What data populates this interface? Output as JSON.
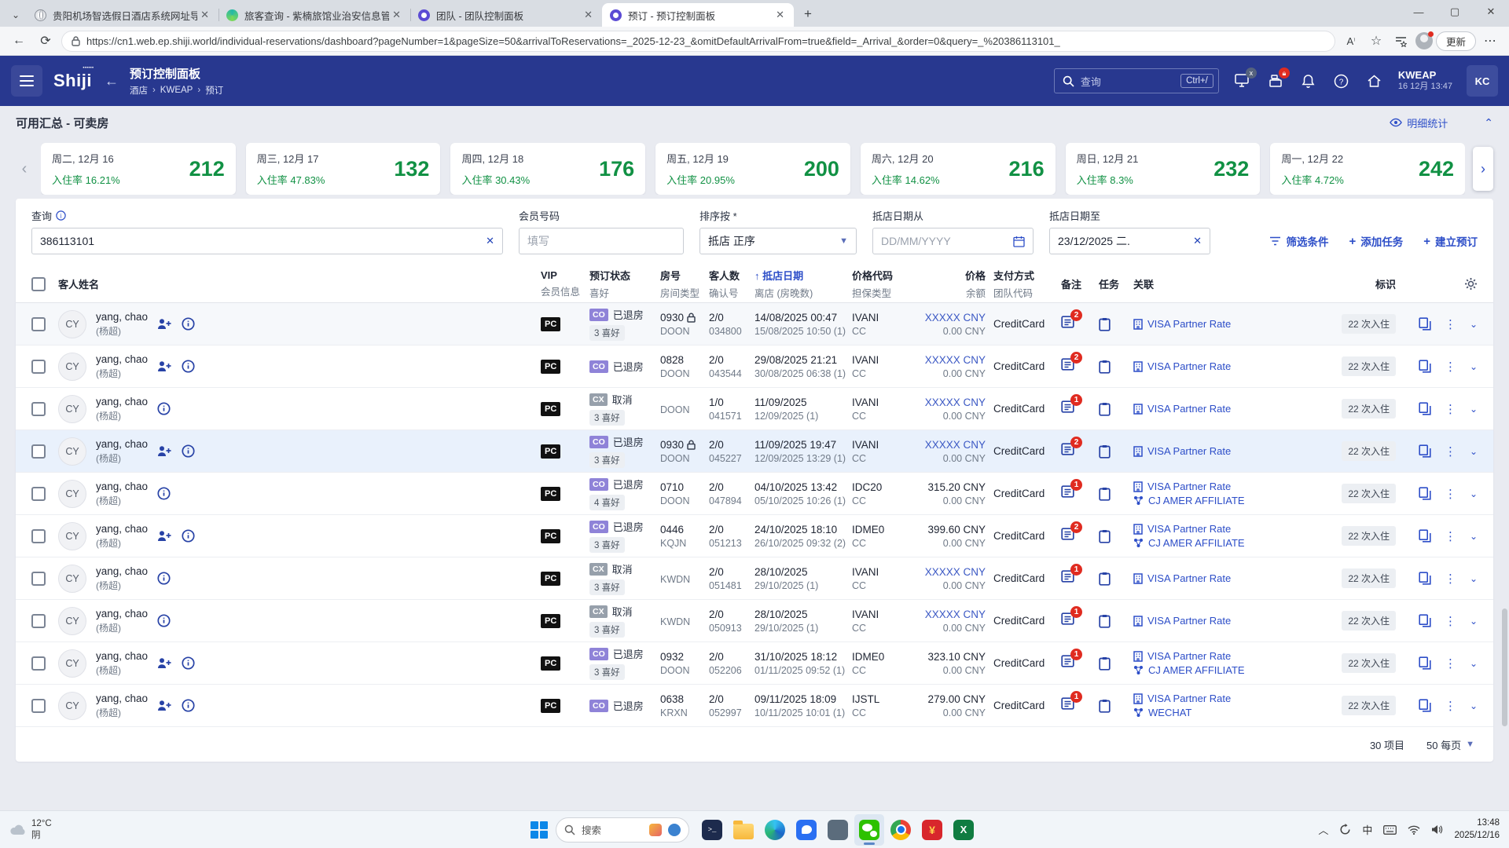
{
  "colors": {
    "header_blue": "#28388f",
    "accent_blue": "#2d4ec8",
    "green": "#119144",
    "red_badge": "#e02b20",
    "co_badge": "#8f83d8",
    "cx_badge": "#97a0ab",
    "wechat_green": "#2dc100"
  },
  "browser": {
    "tabs": [
      {
        "title": "贵阳机场智选假日酒店系统网址导",
        "favicon": "globe",
        "active": false
      },
      {
        "title": "旅客查询 - 紫楠旅馆业治安信息管",
        "favicon": "teal",
        "active": false
      },
      {
        "title": "团队 - 团队控制面板",
        "favicon": "purple",
        "active": false
      },
      {
        "title": "预订 - 预订控制面板",
        "favicon": "purple",
        "active": true
      }
    ],
    "url": "https://cn1.web.ep.shiji.world/individual-reservations/dashboard?pageNumber=1&pageSize=50&arrivalToReservations=_2025-12-23_&omitDefaultArrivalFrom=true&field=_Arrival_&order=0&query=_%20386113101_",
    "update_button": "更新"
  },
  "header": {
    "logo": "Shiji",
    "title": "预订控制面板",
    "breadcrumb": [
      "酒店",
      "KWEAP",
      "预订"
    ],
    "search_placeholder": "查询",
    "search_shortcut": "Ctrl+/",
    "property": "KWEAP",
    "datetime": "16 12月 13:47",
    "avatar": "KC"
  },
  "availability": {
    "title": "可用汇总 - 可卖房",
    "detail_link": "明细统计",
    "occupancy_label": "入住率",
    "cards": [
      {
        "date": "周二, 12月 16",
        "occupancy": "16.21%",
        "available": "212"
      },
      {
        "date": "周三, 12月 17",
        "occupancy": "47.83%",
        "available": "132"
      },
      {
        "date": "周四, 12月 18",
        "occupancy": "30.43%",
        "available": "176"
      },
      {
        "date": "周五, 12月 19",
        "occupancy": "20.95%",
        "available": "200"
      },
      {
        "date": "周六, 12月 20",
        "occupancy": "14.62%",
        "available": "216"
      },
      {
        "date": "周日, 12月 21",
        "occupancy": "8.3%",
        "available": "232"
      },
      {
        "date": "周一, 12月 22",
        "occupancy": "4.72%",
        "available": "242"
      }
    ]
  },
  "filters": {
    "query_label": "查询",
    "query_value": "386113101",
    "member_label": "会员号码",
    "member_placeholder": "填写",
    "sort_label": "排序按 *",
    "sort_value": "抵店 正序",
    "arrival_from_label": "抵店日期从",
    "arrival_from_placeholder": "DD/MM/YYYY",
    "arrival_to_label": "抵店日期至",
    "arrival_to_value": "23/12/2025 二.",
    "btn_filter": "筛选条件",
    "btn_add_task": "添加任务",
    "btn_new_reservation": "建立预订"
  },
  "table": {
    "headers": {
      "guest": "客人姓名",
      "vip": [
        "VIP",
        "会员信息"
      ],
      "status": [
        "预订状态",
        "喜好"
      ],
      "room": [
        "房号",
        "房间类型"
      ],
      "guests": [
        "客人数",
        "确认号"
      ],
      "arrival": [
        "抵店日期",
        "离店 (房晚数)"
      ],
      "rate": [
        "价格代码",
        "担保类型"
      ],
      "price": [
        "价格",
        "余额"
      ],
      "payment": [
        "支付方式",
        "团队代码"
      ],
      "notes": "备注",
      "tasks": "任务",
      "links": "关联",
      "tag": "标识"
    },
    "rows": [
      {
        "initials": "CY",
        "name": "yang, chao",
        "alt_name": "(杨超)",
        "contact_icon": true,
        "vip": "PC",
        "status_code": "CO",
        "status": "已退房",
        "status_kind": "co",
        "prefs": "3 喜好",
        "room": "0930",
        "locked": true,
        "room_type": "DOON",
        "guests": "2/0",
        "conf": "034800",
        "arrival": "14/08/2025 00:47",
        "departure": "15/08/2025 10:50 (1)",
        "rate_code": "IVANI",
        "guarantee": "CC",
        "price": "XXXXX CNY",
        "price_masked": true,
        "balance": "0.00 CNY",
        "payment": "CreditCard",
        "notes": "2",
        "links": [
          {
            "icon": "building",
            "label": "VISA Partner Rate"
          }
        ],
        "tag": "22 次入住",
        "highlight": false
      },
      {
        "initials": "CY",
        "name": "yang, chao",
        "alt_name": "(杨超)",
        "contact_icon": true,
        "vip": "PC",
        "status_code": "CO",
        "status": "已退房",
        "status_kind": "co",
        "prefs": "",
        "room": "0828",
        "locked": false,
        "room_type": "DOON",
        "guests": "2/0",
        "conf": "043544",
        "arrival": "29/08/2025 21:21",
        "departure": "30/08/2025 06:38 (1)",
        "rate_code": "IVANI",
        "guarantee": "CC",
        "price": "XXXXX CNY",
        "price_masked": true,
        "balance": "0.00 CNY",
        "payment": "CreditCard",
        "notes": "2",
        "links": [
          {
            "icon": "building",
            "label": "VISA Partner Rate"
          }
        ],
        "tag": "22 次入住",
        "highlight": false
      },
      {
        "initials": "CY",
        "name": "yang, chao",
        "alt_name": "(杨超)",
        "contact_icon": false,
        "vip": "PC",
        "status_code": "CX",
        "status": "取消",
        "status_kind": "cx",
        "prefs": "3 喜好",
        "room": "",
        "locked": false,
        "room_type": "DOON",
        "guests": "1/0",
        "conf": "041571",
        "arrival": "11/09/2025",
        "departure": "12/09/2025 (1)",
        "rate_code": "IVANI",
        "guarantee": "CC",
        "price": "XXXXX CNY",
        "price_masked": true,
        "balance": "0.00 CNY",
        "payment": "CreditCard",
        "notes": "1",
        "links": [
          {
            "icon": "building",
            "label": "VISA Partner Rate"
          }
        ],
        "tag": "22 次入住",
        "highlight": false
      },
      {
        "initials": "CY",
        "name": "yang, chao",
        "alt_name": "(杨超)",
        "contact_icon": true,
        "vip": "PC",
        "status_code": "CO",
        "status": "已退房",
        "status_kind": "co",
        "prefs": "3 喜好",
        "room": "0930",
        "locked": true,
        "room_type": "DOON",
        "guests": "2/0",
        "conf": "045227",
        "arrival": "11/09/2025 19:47",
        "departure": "12/09/2025 13:29 (1)",
        "rate_code": "IVANI",
        "guarantee": "CC",
        "price": "XXXXX CNY",
        "price_masked": true,
        "balance": "0.00 CNY",
        "payment": "CreditCard",
        "notes": "2",
        "links": [
          {
            "icon": "building",
            "label": "VISA Partner Rate"
          }
        ],
        "tag": "22 次入住",
        "highlight": true
      },
      {
        "initials": "CY",
        "name": "yang, chao",
        "alt_name": "(杨超)",
        "contact_icon": false,
        "vip": "PC",
        "status_code": "CO",
        "status": "已退房",
        "status_kind": "co",
        "prefs": "4 喜好",
        "room": "0710",
        "locked": false,
        "room_type": "DOON",
        "guests": "2/0",
        "conf": "047894",
        "arrival": "04/10/2025 13:42",
        "departure": "05/10/2025 10:26 (1)",
        "rate_code": "IDC20",
        "guarantee": "CC",
        "price": "315.20 CNY",
        "price_masked": false,
        "balance": "0.00 CNY",
        "payment": "CreditCard",
        "notes": "1",
        "links": [
          {
            "icon": "building",
            "label": "VISA Partner Rate"
          },
          {
            "icon": "affiliate",
            "label": "CJ AMER AFFILIATE"
          }
        ],
        "tag": "22 次入住",
        "highlight": false
      },
      {
        "initials": "CY",
        "name": "yang, chao",
        "alt_name": "(杨超)",
        "contact_icon": true,
        "vip": "PC",
        "status_code": "CO",
        "status": "已退房",
        "status_kind": "co",
        "prefs": "3 喜好",
        "room": "0446",
        "locked": false,
        "room_type": "KQJN",
        "guests": "2/0",
        "conf": "051213",
        "arrival": "24/10/2025 18:10",
        "departure": "26/10/2025 09:32 (2)",
        "rate_code": "IDME0",
        "guarantee": "CC",
        "price": "399.60 CNY",
        "price_masked": false,
        "balance": "0.00 CNY",
        "payment": "CreditCard",
        "notes": "2",
        "links": [
          {
            "icon": "building",
            "label": "VISA Partner Rate"
          },
          {
            "icon": "affiliate",
            "label": "CJ AMER AFFILIATE"
          }
        ],
        "tag": "22 次入住",
        "highlight": false
      },
      {
        "initials": "CY",
        "name": "yang, chao",
        "alt_name": "(杨超)",
        "contact_icon": false,
        "vip": "PC",
        "status_code": "CX",
        "status": "取消",
        "status_kind": "cx",
        "prefs": "3 喜好",
        "room": "",
        "locked": false,
        "room_type": "KWDN",
        "guests": "2/0",
        "conf": "051481",
        "arrival": "28/10/2025",
        "departure": "29/10/2025 (1)",
        "rate_code": "IVANI",
        "guarantee": "CC",
        "price": "XXXXX CNY",
        "price_masked": true,
        "balance": "0.00 CNY",
        "payment": "CreditCard",
        "notes": "1",
        "links": [
          {
            "icon": "building",
            "label": "VISA Partner Rate"
          }
        ],
        "tag": "22 次入住",
        "highlight": false
      },
      {
        "initials": "CY",
        "name": "yang, chao",
        "alt_name": "(杨超)",
        "contact_icon": false,
        "vip": "PC",
        "status_code": "CX",
        "status": "取消",
        "status_kind": "cx",
        "prefs": "3 喜好",
        "room": "",
        "locked": false,
        "room_type": "KWDN",
        "guests": "2/0",
        "conf": "050913",
        "arrival": "28/10/2025",
        "departure": "29/10/2025 (1)",
        "rate_code": "IVANI",
        "guarantee": "CC",
        "price": "XXXXX CNY",
        "price_masked": true,
        "balance": "0.00 CNY",
        "payment": "CreditCard",
        "notes": "1",
        "links": [
          {
            "icon": "building",
            "label": "VISA Partner Rate"
          }
        ],
        "tag": "22 次入住",
        "highlight": false
      },
      {
        "initials": "CY",
        "name": "yang, chao",
        "alt_name": "(杨超)",
        "contact_icon": true,
        "vip": "PC",
        "status_code": "CO",
        "status": "已退房",
        "status_kind": "co",
        "prefs": "3 喜好",
        "room": "0932",
        "locked": false,
        "room_type": "DOON",
        "guests": "2/0",
        "conf": "052206",
        "arrival": "31/10/2025 18:12",
        "departure": "01/11/2025 09:52 (1)",
        "rate_code": "IDME0",
        "guarantee": "CC",
        "price": "323.10 CNY",
        "price_masked": false,
        "balance": "0.00 CNY",
        "payment": "CreditCard",
        "notes": "1",
        "links": [
          {
            "icon": "building",
            "label": "VISA Partner Rate"
          },
          {
            "icon": "affiliate",
            "label": "CJ AMER AFFILIATE"
          }
        ],
        "tag": "22 次入住",
        "highlight": false
      },
      {
        "initials": "CY",
        "name": "yang, chao",
        "alt_name": "(杨超)",
        "contact_icon": true,
        "vip": "PC",
        "status_code": "CO",
        "status": "已退房",
        "status_kind": "co",
        "prefs": "",
        "room": "0638",
        "locked": false,
        "room_type": "KRXN",
        "guests": "2/0",
        "conf": "052997",
        "arrival": "09/11/2025 18:09",
        "departure": "10/11/2025 10:01 (1)",
        "rate_code": "IJSTL",
        "guarantee": "CC",
        "price": "279.00 CNY",
        "price_masked": false,
        "balance": "0.00 CNY",
        "payment": "CreditCard",
        "notes": "1",
        "links": [
          {
            "icon": "building",
            "label": "VISA Partner Rate"
          },
          {
            "icon": "affiliate",
            "label": "WECHAT"
          }
        ],
        "tag": "22 次入住",
        "highlight": false
      }
    ]
  },
  "pagination": {
    "items": "30 项目",
    "per_page": "50 每页"
  },
  "taskbar": {
    "weather_temp": "12°C",
    "weather_cond": "阴",
    "search_placeholder": "搜索",
    "apps": [
      {
        "name": "terminal",
        "active": false
      },
      {
        "name": "file-explorer",
        "active": false
      },
      {
        "name": "edge",
        "active": false
      },
      {
        "name": "wecom",
        "active": false
      },
      {
        "name": "calculator",
        "active": false
      },
      {
        "name": "wechat",
        "active": true
      },
      {
        "name": "chrome",
        "active": false
      },
      {
        "name": "finance",
        "active": false
      },
      {
        "name": "excel",
        "active": false
      }
    ],
    "ime": "中",
    "time": "13:48",
    "date": "2025/12/16"
  }
}
